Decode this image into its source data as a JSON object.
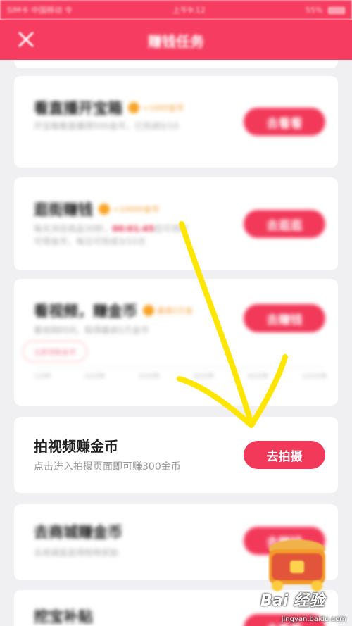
{
  "status_bar": {
    "carrier": "SIM卡 中国移动 令",
    "time": "上午9:12",
    "battery": "55%"
  },
  "header": {
    "title": "赚钱任务"
  },
  "cards": [
    {
      "title": "看直播开宝箱",
      "reward": "+1000金币",
      "desc": "开宝箱看直播得500金币，已完成0/10",
      "button": "去看看"
    },
    {
      "title": "逛街赚钱",
      "reward": "+10000金币",
      "desc_a": "每天浏览商品30秒，",
      "desc_hl": "00:01:45",
      "desc_b": "后可领取",
      "desc_c": "可得金币，每日可完成3/10次",
      "button": "去逛逛"
    },
    {
      "title": "看视频，赚金币",
      "reward": "最高5万金",
      "desc": "看视频时间，取得最高5万金币",
      "chip": "立即领取金币",
      "ticks": [
        "1分钟",
        "10分钟",
        "20分钟",
        "30分钟",
        "60分钟",
        "120分钟"
      ],
      "button": "去赚钱"
    },
    {
      "title": "拍视频赚金币",
      "desc": "点击进入拍摄页面即可赚300金币",
      "button": "去拍摄"
    },
    {
      "title": "去商城赚金币",
      "desc": "去商城逛逛得购物奖励",
      "button": "去赚钱"
    },
    {
      "title": "挖宝补贴",
      "button": "去看看"
    }
  ],
  "watermark": {
    "brand": "Bai 经验",
    "url": "jingyan.baidu.com"
  },
  "colors": {
    "brand": "#f63d5f",
    "button": "#f2395a",
    "coin": "#f7a324",
    "annotation": "#ffe600"
  }
}
